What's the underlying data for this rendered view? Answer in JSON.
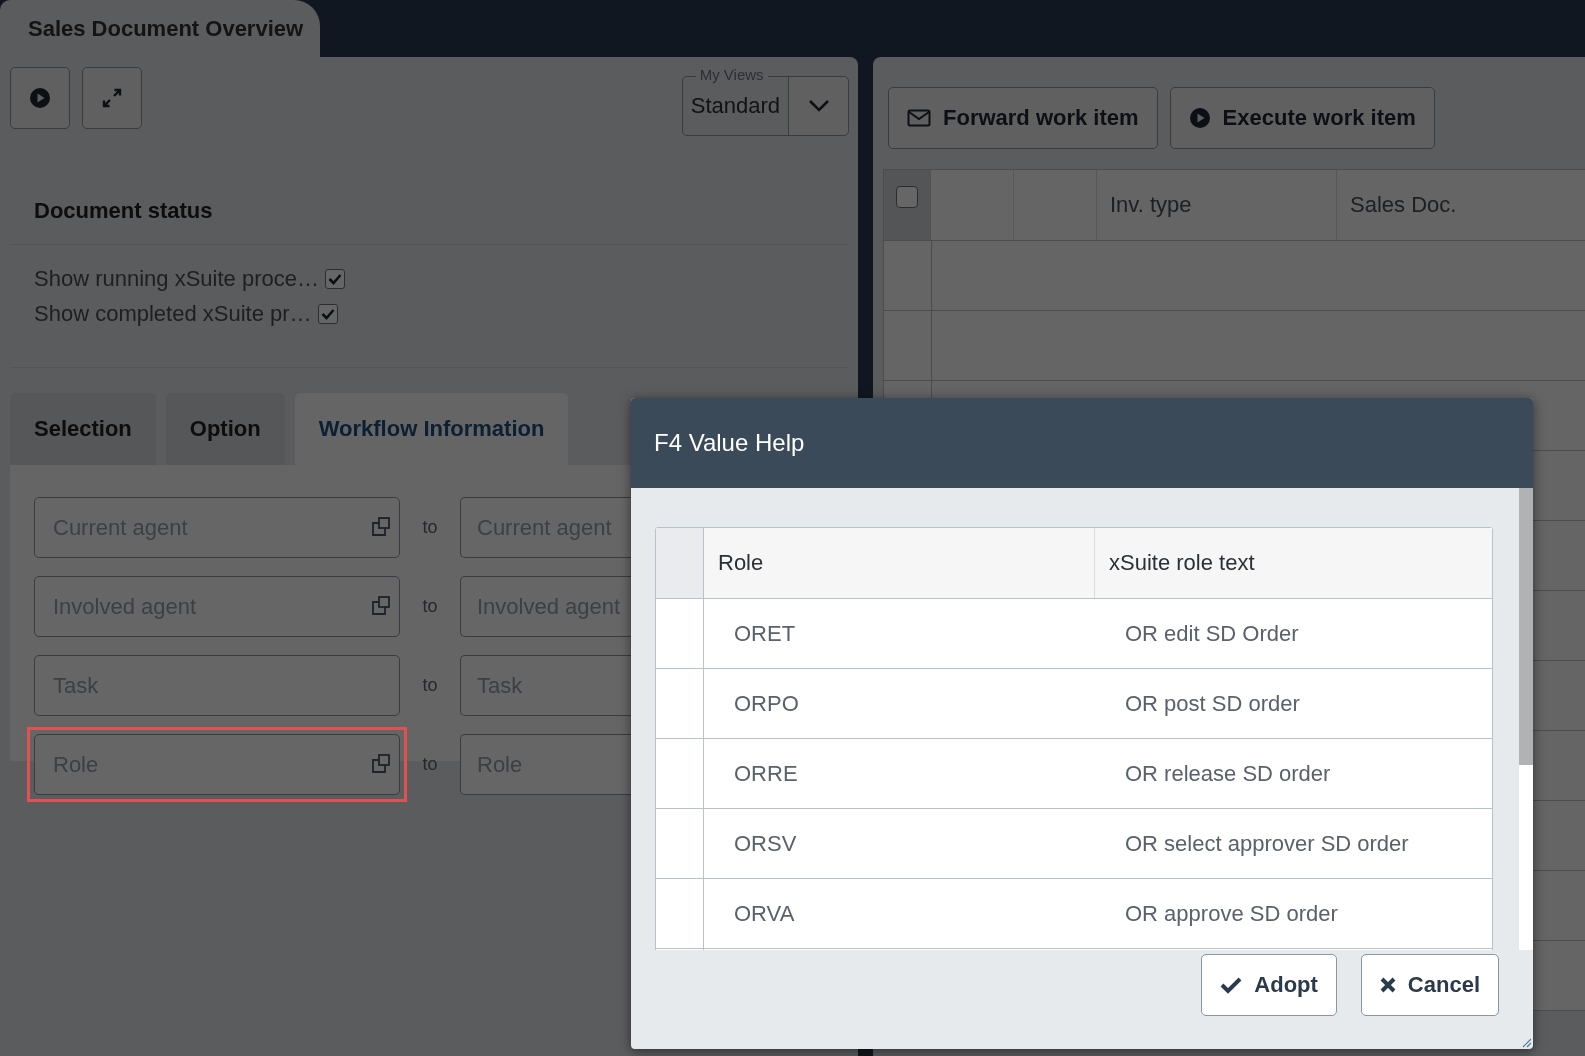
{
  "app_tab": {
    "title": "Sales Document Overview"
  },
  "my_views": {
    "legend": "My Views",
    "value": "Standard"
  },
  "document_status": {
    "heading": "Document status",
    "options": [
      {
        "label": "Show running xSuite proce…",
        "checked": true
      },
      {
        "label": "Show completed xSuite pr…",
        "checked": true
      }
    ]
  },
  "tabs": [
    {
      "label": "Selection",
      "selected": false
    },
    {
      "label": "Option",
      "selected": false
    },
    {
      "label": "Workflow Information",
      "selected": true
    }
  ],
  "range_fields": [
    {
      "from": {
        "placeholder": "Current agent",
        "value_help": true,
        "highlighted": false
      },
      "separator": "to",
      "to": {
        "placeholder": "Current agent"
      }
    },
    {
      "from": {
        "placeholder": "Involved agent",
        "value_help": true,
        "highlighted": false
      },
      "separator": "to",
      "to": {
        "placeholder": "Involved agent"
      }
    },
    {
      "from": {
        "placeholder": "Task",
        "value_help": false,
        "highlighted": false
      },
      "separator": "to",
      "to": {
        "placeholder": "Task"
      }
    },
    {
      "from": {
        "placeholder": "Role",
        "value_help": true,
        "highlighted": true
      },
      "separator": "to",
      "to": {
        "placeholder": "Role"
      }
    }
  ],
  "work_item_buttons": [
    {
      "label": "Forward work item",
      "kind": "forward"
    },
    {
      "label": "Execute work item",
      "kind": "execute"
    }
  ],
  "work_items_table": {
    "select_all_checked": false,
    "columns": [
      "Inv. type",
      "Sales Doc."
    ]
  },
  "dialog": {
    "title": "F4 Value Help",
    "columns": [
      "Role",
      "xSuite role text"
    ],
    "rows": [
      {
        "role": "ORET",
        "text": "OR edit SD Order"
      },
      {
        "role": "ORPO",
        "text": "OR post SD order"
      },
      {
        "role": "ORRE",
        "text": "OR release SD order"
      },
      {
        "role": "ORSV",
        "text": "OR select approver SD order"
      },
      {
        "role": "ORVA",
        "text": "OR approve SD order"
      }
    ],
    "buttons": [
      {
        "label": "Adopt",
        "kind": "confirm"
      },
      {
        "label": "Cancel",
        "kind": "cancel"
      }
    ]
  }
}
